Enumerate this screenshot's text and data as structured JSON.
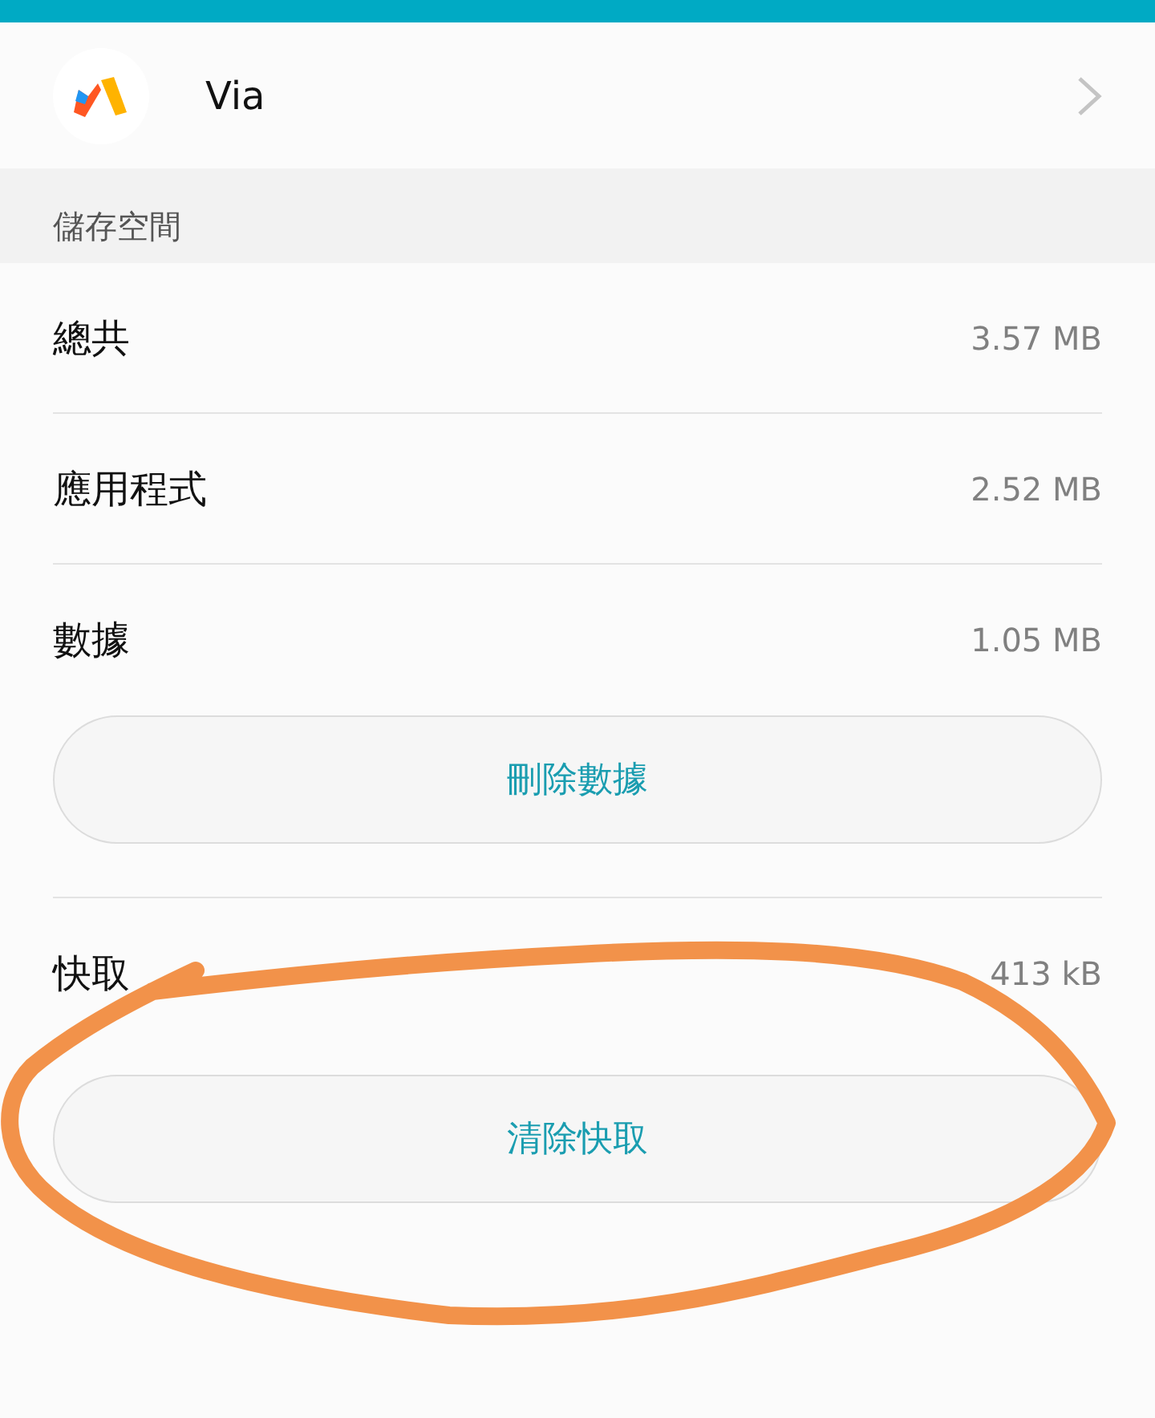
{
  "app": {
    "name": "Via"
  },
  "section": {
    "title": "儲存空間"
  },
  "rows": [
    {
      "label": "總共",
      "value": "3.57 MB"
    },
    {
      "label": "應用程式",
      "value": "2.52 MB"
    },
    {
      "label": "數據",
      "value": "1.05 MB"
    }
  ],
  "clear_data_button": "刪除數據",
  "cache": {
    "label": "快取",
    "value": "413 kB",
    "button": "清除快取"
  },
  "annotation": {
    "kind": "circle"
  }
}
